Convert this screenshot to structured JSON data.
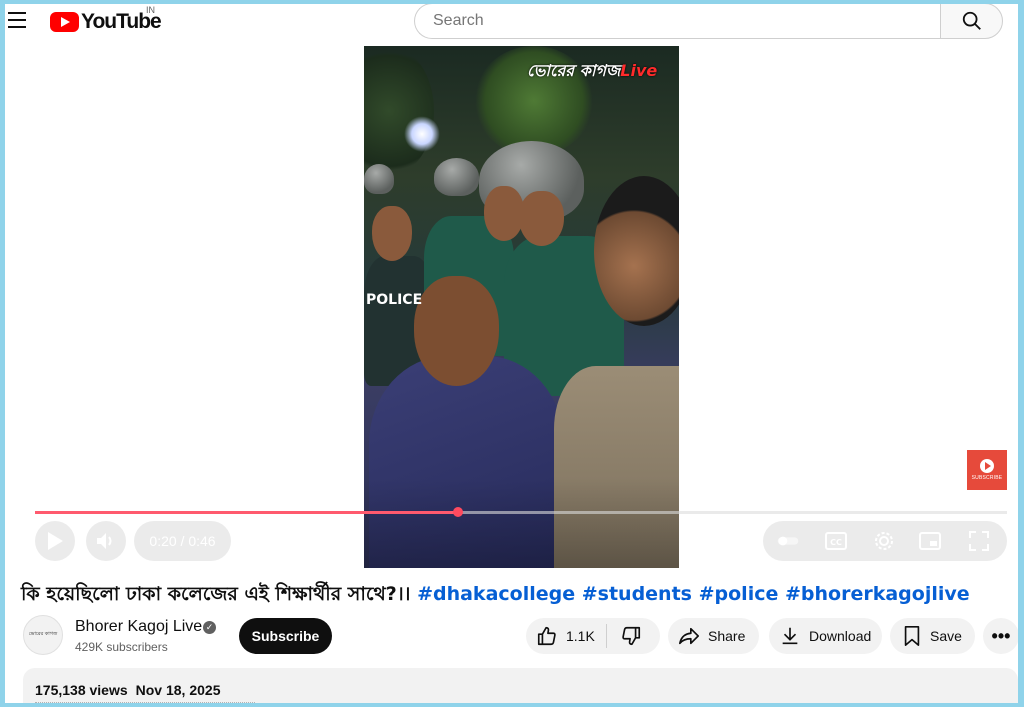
{
  "header": {
    "logo_text": "YouTube",
    "country_code": "IN",
    "search_placeholder": "Search"
  },
  "player": {
    "watermark_main": "ভোরের কাগজ",
    "watermark_accent": "Live",
    "time_display": "0:20 / 0:46",
    "progress_fraction": 0.4348,
    "subscribe_badge_text": "SUBSCRIBE",
    "in_video_text": "POLICE"
  },
  "video": {
    "title_bengali": "কি হয়েছিলো ঢাকা কলেজের এই শিক্ষার্থীর সাথে?।।",
    "hashtags": [
      "#dhakacollege",
      "#students",
      "#police",
      "#bhorerkagojlive"
    ],
    "views": "175,138 views",
    "date": "Nov 18, 2025"
  },
  "channel": {
    "name": "Bhorer Kagoj Live",
    "subscribers": "429K subscribers",
    "avatar_text": "ভোরের কাগজ",
    "subscribe_label": "Subscribe"
  },
  "actions": {
    "like_count": "1.1K",
    "share_label": "Share",
    "download_label": "Download",
    "save_label": "Save",
    "more_label": "•••"
  },
  "colors": {
    "brand_red": "#ff0000",
    "progress_red": "#ff5a6e",
    "hashtag_blue": "#065fd4",
    "subscribe_bg": "#0f0f0f",
    "page_border": "#8fd3ea"
  }
}
